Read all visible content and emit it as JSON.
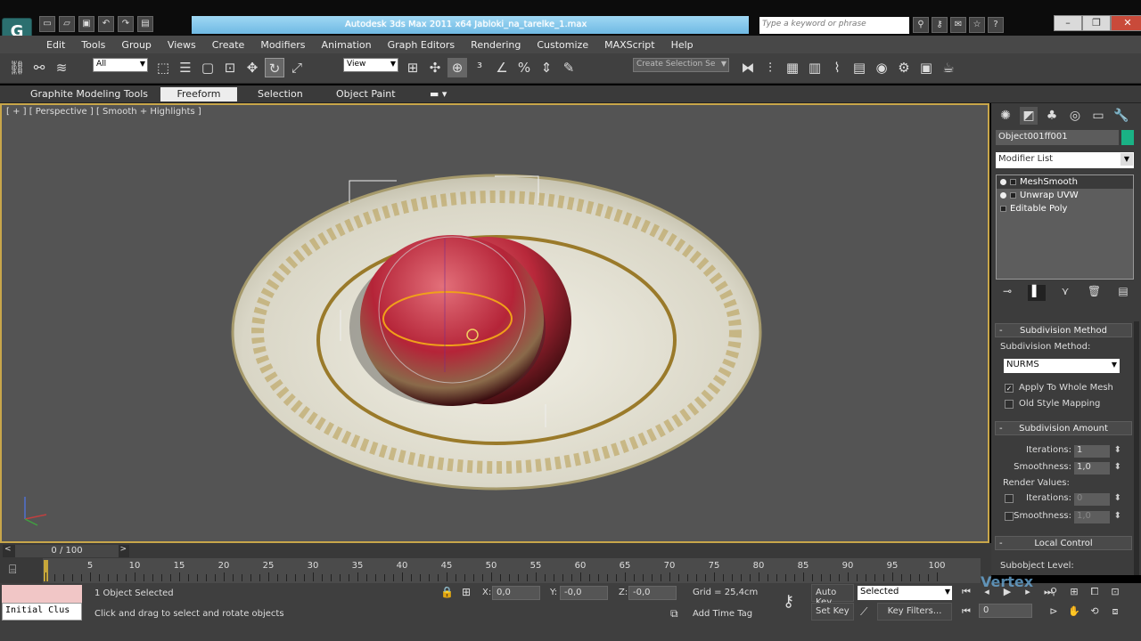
{
  "app": {
    "title": "Autodesk 3ds Max  2011 x64     Jabloki_na_tarelke_1.max",
    "logo": "G",
    "search_placeholder": "Type a keyword or phrase",
    "accent": "#2b6f6f"
  },
  "menu": [
    "Edit",
    "Tools",
    "Group",
    "Views",
    "Create",
    "Modifiers",
    "Animation",
    "Graph Editors",
    "Rendering",
    "Customize",
    "MAXScript",
    "Help"
  ],
  "toolbar": {
    "filter_value": "All",
    "refcoord_value": "View",
    "selection_set_placeholder": "Create Selection Se"
  },
  "ribbon": {
    "tabs": [
      "Graphite Modeling Tools",
      "Freeform",
      "Selection",
      "Object Paint"
    ],
    "active": "Freeform"
  },
  "viewport": {
    "label": "[ + ] [ Perspective ] [ Smooth + Highlights ]",
    "active_border": "#c8a64a"
  },
  "command_panel": {
    "object_name": "Object001ff001",
    "object_color": "#1ab285",
    "modifier_list": "Modifier List",
    "stack": [
      {
        "label": "MeshSmooth",
        "selected": true
      },
      {
        "label": "Unwrap UVW",
        "selected": false
      },
      {
        "label": "Editable Poly",
        "selected": false
      }
    ],
    "subdivision_method": {
      "header": "Subdivision Method",
      "label": "Subdivision Method:",
      "value": "NURMS",
      "apply_whole_mesh": "Apply To Whole Mesh",
      "old_style_mapping": "Old Style Mapping"
    },
    "subdivision_amount": {
      "header": "Subdivision Amount",
      "iterations_label": "Iterations:",
      "iterations_value": "1",
      "smoothness_label": "Smoothness:",
      "smoothness_value": "1,0",
      "render_values": "Render Values:",
      "r_iterations_label": "Iterations:",
      "r_iterations_value": "0",
      "r_smoothness_label": "Smoothness:",
      "r_smoothness_value": "1,0"
    },
    "local_control": {
      "header": "Local Control",
      "sublevel_label": "Subobject Level:"
    }
  },
  "timeline": {
    "frame_display": "0 / 100",
    "ticks": [
      5,
      10,
      15,
      20,
      25,
      30,
      35,
      40,
      45,
      50,
      55,
      60,
      65,
      70,
      75,
      80,
      85,
      90,
      95,
      100
    ]
  },
  "status": {
    "maxscript_text": "Initial Clus",
    "selected_count": "1 Object Selected",
    "prompt": "Click and drag to select and rotate objects",
    "x_label": "X:",
    "x_value": "0,0",
    "y_label": "Y:",
    "y_value": "-0,0",
    "z_label": "Z:",
    "z_value": "-0,0",
    "grid": "Grid = 25,4cm",
    "add_time_tag": "Add Time Tag",
    "auto_key": "Auto Key",
    "set_key": "Set Key",
    "key_mode_value": "Selected",
    "key_filters": "Key Filters...",
    "current_frame": "0",
    "watermark": "Vertex"
  }
}
